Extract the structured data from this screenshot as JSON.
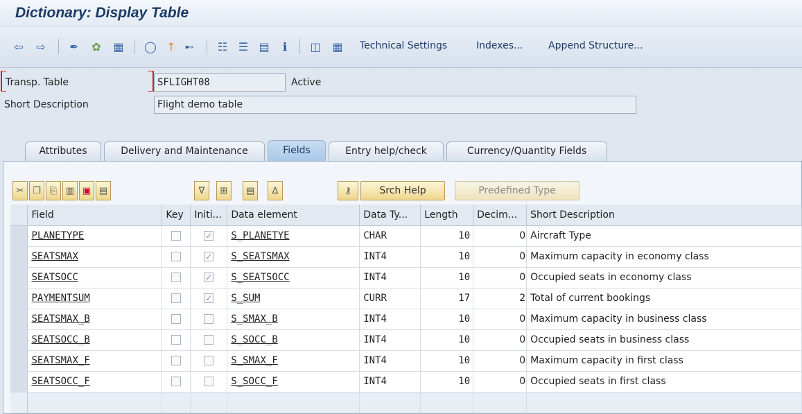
{
  "window": {
    "title": "Dictionary: Display Table"
  },
  "toolbar": {
    "text_buttons": [
      "Technical Settings",
      "Indexes...",
      "Append Structure..."
    ]
  },
  "header": {
    "table_label": "Transp. Table",
    "table_value": "SFLIGHT08",
    "status": "Active",
    "desc_label": "Short Description",
    "desc_value": "Flight demo table"
  },
  "tabs": [
    {
      "label": "Attributes",
      "active": false
    },
    {
      "label": "Delivery and Maintenance",
      "active": false
    },
    {
      "label": "Fields",
      "active": true
    },
    {
      "label": "Entry help/check",
      "active": false
    },
    {
      "label": "Currency/Quantity Fields",
      "active": false
    }
  ],
  "fieldtools": {
    "srch_help": "Srch Help",
    "predefined_type": "Predefined Type"
  },
  "columns": [
    "Field",
    "Key",
    "Initi...",
    "Data element",
    "Data Ty...",
    "Length",
    "Decim...",
    "Short Description"
  ],
  "rows": [
    {
      "field": "PLANETYPE",
      "key": false,
      "init": true,
      "element": "S_PLANETYE",
      "type": "CHAR",
      "length": "10",
      "dec": "0",
      "desc": "Aircraft Type"
    },
    {
      "field": "SEATSMAX",
      "key": false,
      "init": true,
      "element": "S_SEATSMAX",
      "type": "INT4",
      "length": "10",
      "dec": "0",
      "desc": "Maximum capacity in economy class"
    },
    {
      "field": "SEATSOCC",
      "key": false,
      "init": true,
      "element": "S_SEATSOCC",
      "type": "INT4",
      "length": "10",
      "dec": "0",
      "desc": "Occupied seats in economy class"
    },
    {
      "field": "PAYMENTSUM",
      "key": false,
      "init": true,
      "element": "S_SUM",
      "type": "CURR",
      "length": "17",
      "dec": "2",
      "desc": "Total of current bookings"
    },
    {
      "field": "SEATSMAX_B",
      "key": false,
      "init": false,
      "element": "S_SMAX_B",
      "type": "INT4",
      "length": "10",
      "dec": "0",
      "desc": "Maximum capacity in business class"
    },
    {
      "field": "SEATSOCC_B",
      "key": false,
      "init": false,
      "element": "S_SOCC_B",
      "type": "INT4",
      "length": "10",
      "dec": "0",
      "desc": "Occupied seats in business class"
    },
    {
      "field": "SEATSMAX_F",
      "key": false,
      "init": false,
      "element": "S_SMAX_F",
      "type": "INT4",
      "length": "10",
      "dec": "0",
      "desc": "Maximum capacity in first class"
    },
    {
      "field": "SEATSOCC_F",
      "key": false,
      "init": false,
      "element": "S_SOCC_F",
      "type": "INT4",
      "length": "10",
      "dec": "0",
      "desc": "Occupied seats in first class"
    }
  ],
  "colors": {
    "title": "#1c3a66",
    "accent_tab": "#a9c8e8",
    "button_gold": "#efd68c"
  }
}
